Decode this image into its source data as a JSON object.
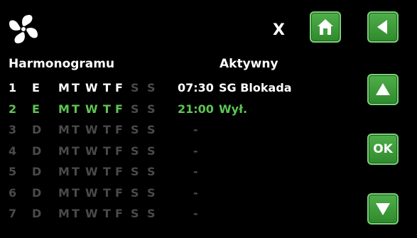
{
  "top": {
    "close_label": "X"
  },
  "buttons": {
    "ok_label": "OK"
  },
  "headers": {
    "schedule": "Harmonogramu",
    "active": "Aktywny"
  },
  "days_letters": [
    "M",
    "T",
    "W",
    "T",
    "F",
    "S",
    "S"
  ],
  "rows": [
    {
      "num": "1",
      "mode": "E",
      "active_days": [
        true,
        true,
        true,
        true,
        true,
        false,
        false
      ],
      "time": "07:30",
      "status": "SG Blokada",
      "style": "white"
    },
    {
      "num": "2",
      "mode": "E",
      "active_days": [
        true,
        true,
        true,
        true,
        true,
        false,
        false
      ],
      "time": "21:00",
      "status": "Wył.",
      "style": "green"
    },
    {
      "num": "3",
      "mode": "D",
      "active_days": [
        false,
        false,
        false,
        false,
        false,
        false,
        false
      ],
      "time": "",
      "status": "-",
      "style": "dim"
    },
    {
      "num": "4",
      "mode": "D",
      "active_days": [
        false,
        false,
        false,
        false,
        false,
        false,
        false
      ],
      "time": "",
      "status": "-",
      "style": "dim"
    },
    {
      "num": "5",
      "mode": "D",
      "active_days": [
        false,
        false,
        false,
        false,
        false,
        false,
        false
      ],
      "time": "",
      "status": "-",
      "style": "dim"
    },
    {
      "num": "6",
      "mode": "D",
      "active_days": [
        false,
        false,
        false,
        false,
        false,
        false,
        false
      ],
      "time": "",
      "status": "-",
      "style": "dim"
    },
    {
      "num": "7",
      "mode": "D",
      "active_days": [
        false,
        false,
        false,
        false,
        false,
        false,
        false
      ],
      "time": "",
      "status": "-",
      "style": "dim"
    }
  ],
  "colors": {
    "accent": "#5ec553",
    "button": "#3f9f3b",
    "dim": "#4a4a4a"
  }
}
